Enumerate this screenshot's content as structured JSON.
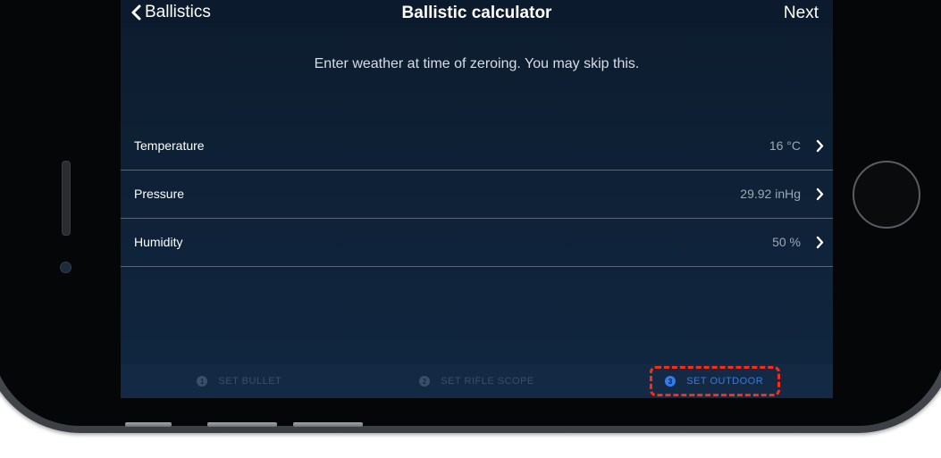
{
  "navbar": {
    "back_label": "Ballistics",
    "title": "Ballistic calculator",
    "next_label": "Next"
  },
  "instruction": "Enter weather at time of zeroing. You  may skip this.",
  "rows": [
    {
      "label": "Temperature",
      "value": "16 °C"
    },
    {
      "label": "Pressure",
      "value": "29.92 inHg"
    },
    {
      "label": "Humidity",
      "value": "50 %"
    }
  ],
  "tabs": [
    {
      "number": "1",
      "label": "SET BULLET"
    },
    {
      "number": "2",
      "label": "SET RIFLE SCOPE"
    },
    {
      "number": "3",
      "label": "SET OUTDOOR"
    }
  ],
  "active_tab": "SET OUTDOOR",
  "colors": {
    "accent": "#2f7bef",
    "highlight": "#ff2b10",
    "background": "#0f2238"
  }
}
